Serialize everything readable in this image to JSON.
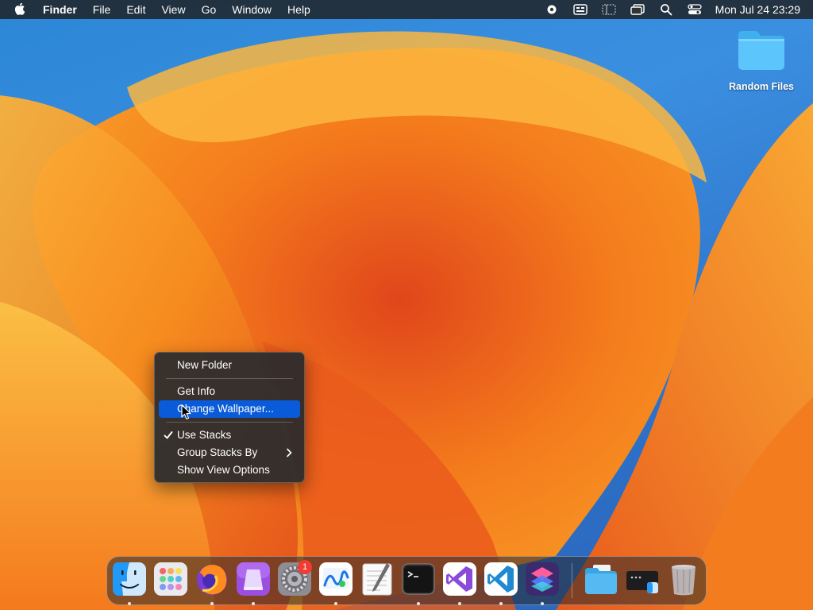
{
  "menubar": {
    "app_name": "Finder",
    "menus": [
      "File",
      "Edit",
      "View",
      "Go",
      "Window",
      "Help"
    ],
    "clock": "Mon Jul 24  23:29",
    "status_icons": [
      "screen-record-icon",
      "keyboard-input-icon",
      "sidebar-icon",
      "window-mirror-icon",
      "spotlight-search-icon",
      "control-center-icon"
    ]
  },
  "desktop": {
    "items": [
      {
        "label": "Random Files",
        "icon": "folder-icon"
      }
    ]
  },
  "context_menu": {
    "items": [
      {
        "label": "New Folder"
      },
      {
        "label": "Get Info"
      },
      {
        "label": "Change Wallpaper..."
      },
      {
        "label": "Use Stacks",
        "checked": true
      },
      {
        "label": "Group Stacks By",
        "submenu": true
      },
      {
        "label": "Show View Options"
      }
    ],
    "highlighted": "Change Wallpaper..."
  },
  "dock": {
    "apps": [
      {
        "name": "Finder",
        "icon": "finder-icon",
        "running": true
      },
      {
        "name": "Launchpad",
        "icon": "launchpad-icon",
        "running": false
      },
      {
        "name": "Firefox",
        "icon": "firefox-icon",
        "running": true
      },
      {
        "name": "Podcast app",
        "icon": "purple-app-icon",
        "running": true
      },
      {
        "name": "System Settings",
        "icon": "settings-gear-icon",
        "running": false,
        "badge": "1"
      },
      {
        "name": "Freeform",
        "icon": "freeform-icon",
        "running": true
      },
      {
        "name": "TextEdit",
        "icon": "textedit-icon",
        "running": false
      },
      {
        "name": "Terminal",
        "icon": "terminal-icon",
        "running": true
      },
      {
        "name": "Visual Studio",
        "icon": "visual-studio-icon",
        "running": true
      },
      {
        "name": "VS Code",
        "icon": "vscode-icon",
        "running": true
      },
      {
        "name": "Shortcuts",
        "icon": "shortcuts-icon",
        "running": true
      },
      {
        "name": "Downloads",
        "icon": "folder-stack-icon",
        "running": false
      },
      {
        "name": "Screenshot app",
        "icon": "screenshot-app-icon",
        "running": false
      },
      {
        "name": "Trash",
        "icon": "trash-icon",
        "running": false
      }
    ]
  },
  "colors": {
    "accent": "#0a5bd9",
    "wallpaper_orange": "#f6921e",
    "wallpaper_blue": "#2c86d6"
  }
}
